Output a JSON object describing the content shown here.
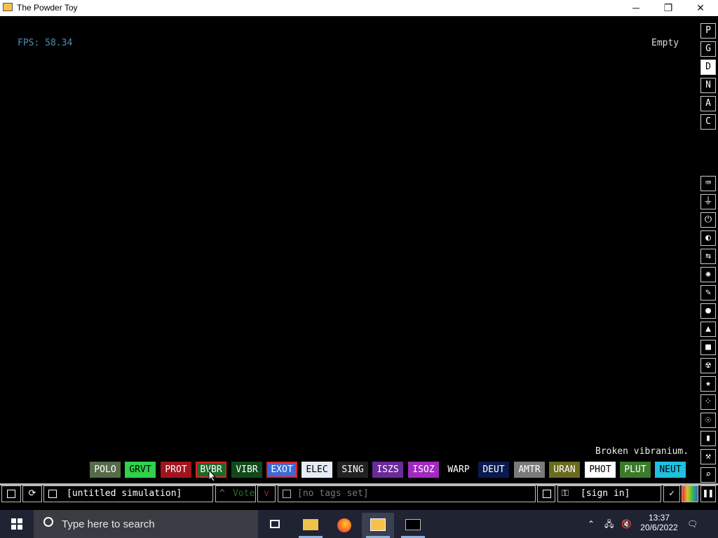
{
  "window": {
    "title": "The Powder Toy",
    "minimize": "─",
    "maximize": "❐",
    "close": "✕"
  },
  "hud": {
    "fps": "FPS: 58.34",
    "hover": "Empty",
    "element_description": "Broken vibranium."
  },
  "right_panel": {
    "top_buttons": [
      "P",
      "G",
      "D",
      "N",
      "A",
      "C"
    ],
    "top_selected": "D",
    "categories": [
      "keyboard",
      "plug",
      "power",
      "gauge",
      "arrows",
      "spray",
      "pen",
      "drop",
      "flask",
      "square",
      "radiation",
      "star",
      "dots",
      "bulb",
      "bookmark",
      "wrench",
      "magnifier"
    ]
  },
  "elements": [
    {
      "label": "POLO",
      "bg": "#556b4a",
      "fg": "#ffffff"
    },
    {
      "label": "GRVT",
      "bg": "#2fd24a",
      "fg": "#000000"
    },
    {
      "label": "PROT",
      "bg": "#a0141e",
      "fg": "#ffffff"
    },
    {
      "label": "BVBR",
      "bg": "#1a6a2a",
      "fg": "#ffffff",
      "highlight": true
    },
    {
      "label": "VIBR",
      "bg": "#104a1a",
      "fg": "#ffffff"
    },
    {
      "label": "EXOT",
      "bg": "#3b6bd8",
      "fg": "#ffffff",
      "highlight": true
    },
    {
      "label": "ELEC",
      "bg": "#e6ecf6",
      "fg": "#000000"
    },
    {
      "label": "SING",
      "bg": "#222222",
      "fg": "#ffffff"
    },
    {
      "label": "ISZS",
      "bg": "#6a2a9a",
      "fg": "#ffffff"
    },
    {
      "label": "ISOZ",
      "bg": "#a02ac0",
      "fg": "#ffffff"
    },
    {
      "label": "WARP",
      "bg": "#000000",
      "fg": "#ffffff"
    },
    {
      "label": "DEUT",
      "bg": "#0a1a50",
      "fg": "#ffffff"
    },
    {
      "label": "AMTR",
      "bg": "#7a7a7a",
      "fg": "#ffffff"
    },
    {
      "label": "URAN",
      "bg": "#6a6a20",
      "fg": "#ffffff"
    },
    {
      "label": "PHOT",
      "bg": "#ffffff",
      "fg": "#000000"
    },
    {
      "label": "PLUT",
      "bg": "#3a7a2a",
      "fg": "#ffffff"
    },
    {
      "label": "NEUT",
      "bg": "#20c0e0",
      "fg": "#000000"
    }
  ],
  "bottom_bar": {
    "save_name": "[untitled simulation]",
    "vote": "Vote",
    "tags": "[no tags set]",
    "sign_in": "[sign in]"
  },
  "taskbar": {
    "search_placeholder": "Type here to search",
    "time": "13:37",
    "date": "20/6/2022"
  }
}
